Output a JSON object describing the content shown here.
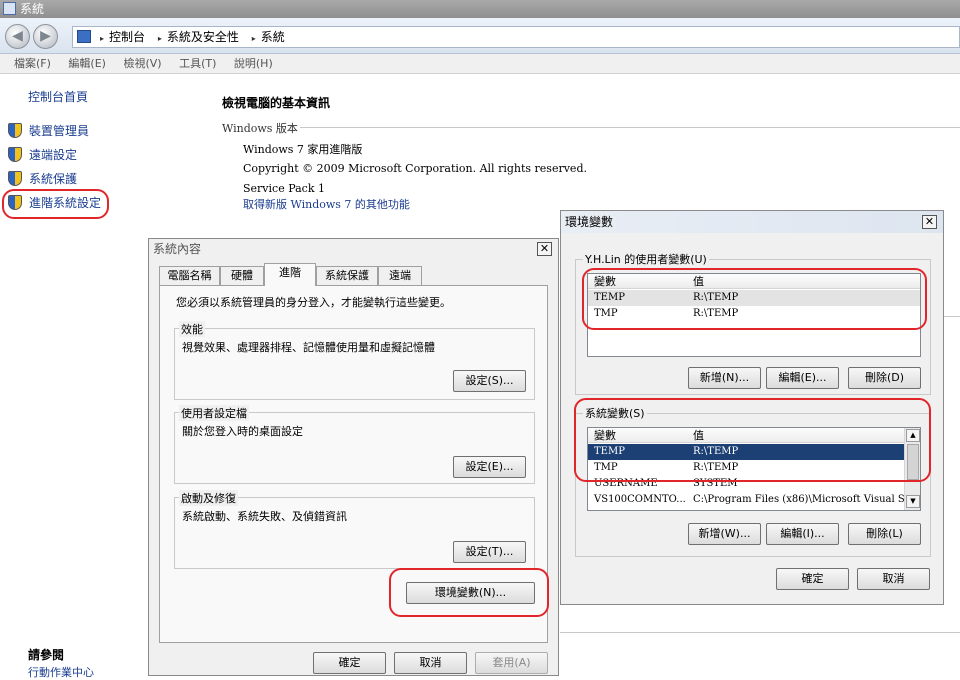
{
  "window": {
    "title": "系統"
  },
  "address": {
    "crumbs": [
      "控制台",
      "系統及安全性",
      "系統"
    ]
  },
  "menu": [
    "檔案(F)",
    "編輯(E)",
    "檢視(V)",
    "工具(T)",
    "說明(H)"
  ],
  "sidebar": {
    "home": "控制台首頁",
    "items": [
      {
        "label": "裝置管理員"
      },
      {
        "label": "遠端設定"
      },
      {
        "label": "系統保護"
      },
      {
        "label": "進階系統設定"
      }
    ],
    "see_also": "請參閱",
    "action_center": "行動作業中心"
  },
  "main": {
    "heading": "檢視電腦的基本資訊",
    "section": "Windows 版本",
    "edition": "Windows 7 家用進階版",
    "copyright": "Copyright © 2009 Microsoft Corporation.  All rights reserved.",
    "service_pack": "Service Pack 1",
    "more_features": "取得新版 Windows 7 的其他功能"
  },
  "system_properties": {
    "title": "系統內容",
    "tabs": [
      "電腦名稱",
      "硬體",
      "進階",
      "系統保護",
      "遠端"
    ],
    "active_tab": "進階",
    "admin_note": "您必須以系統管理員的身分登入，才能變執行這些變更。",
    "performance": {
      "label": "效能",
      "desc": "視覺效果、處理器排程、記憶體使用量和虛擬記憶體",
      "button": "設定(S)..."
    },
    "user_profiles": {
      "label": "使用者設定檔",
      "desc": "關於您登入時的桌面設定",
      "button": "設定(E)..."
    },
    "startup": {
      "label": "啟動及修復",
      "desc": "系統啟動、系統失敗、及偵錯資訊",
      "button": "設定(T)..."
    },
    "env_button": "環境變數(N)...",
    "ok": "確定",
    "cancel": "取消",
    "apply": "套用(A)"
  },
  "env_vars": {
    "title": "環境變數",
    "user_group": "Y.H.Lin 的使用者變數(U)",
    "col_var": "變數",
    "col_val": "值",
    "user_rows": [
      {
        "name": "TEMP",
        "value": "R:\\TEMP"
      },
      {
        "name": "TMP",
        "value": "R:\\TEMP"
      }
    ],
    "user_buttons": [
      "新增(N)...",
      "編輯(E)...",
      "刪除(D)"
    ],
    "system_group": "系統變數(S)",
    "system_rows": [
      {
        "name": "TEMP",
        "value": "R:\\TEMP"
      },
      {
        "name": "TMP",
        "value": "R:\\TEMP"
      },
      {
        "name": "USERNAME",
        "value": "SYSTEM"
      },
      {
        "name": "VS100COMNTO...",
        "value": "C:\\Program Files (x86)\\Microsoft Visual S..."
      }
    ],
    "system_buttons": [
      "新增(W)...",
      "編輯(I)...",
      "刪除(L)"
    ],
    "ok": "確定",
    "cancel": "取消"
  },
  "colors": {
    "highlight_ring": "#e0262b",
    "selection": "#1c3f74",
    "link": "#1a3d8f"
  }
}
